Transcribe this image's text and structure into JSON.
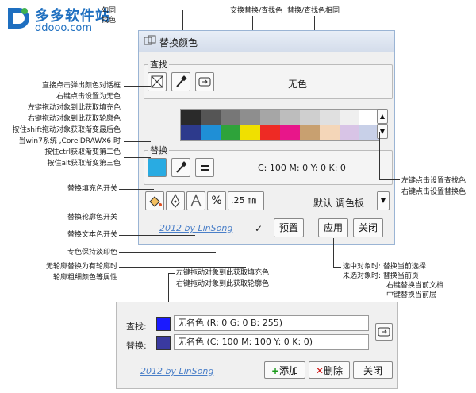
{
  "watermark": {
    "title": "多多软件站",
    "url": "ddooo.com"
  },
  "top_annotations": {
    "a1_line1": "勾同",
    "a1_line2": "找色",
    "swap_find_colors": "交换替换/查找色",
    "replace_same": "替换/查找色相同"
  },
  "left_annotations": [
    "直接点击弹出颜色对话框",
    "右键点击设置为无色",
    "左键拖动对象到此获取填充色",
    "右键拖动对象到此获取轮廓色",
    "按住shift拖动对象获取渐变最后色",
    "当win7系统 ,CorelDRAWX6 时",
    "按住ctrl获取渐变第二色",
    "按住alt获取渐变第三色"
  ],
  "toggle_annotations": {
    "fill": "替换填充色开关",
    "outline": "替换轮廓色开关",
    "text": "替换文本色开关",
    "spot": "专色保持淡印色",
    "no_outline_1": "无轮廓替换为有轮廓时",
    "no_outline_2": "轮廓粗细颜色等属性"
  },
  "right_annotations": {
    "find_set": "左键点击设置查找色",
    "replace_set": "右键点击设置替换色",
    "selected": "选中对象时:  替换当前选择",
    "unselected": "未选对象时:  替换当前页",
    "right_doc": "右键替换当前文档",
    "middle_layer": "中键替换当前层"
  },
  "mid_annotations": {
    "left_fill": "左键拖动对象到此获取填充色",
    "right_outline": "右键拖动对象到此获取轮廓色"
  },
  "dialog": {
    "title": "替换颜色",
    "find_label": "查找",
    "find_value": "无色",
    "replace_label": "替换",
    "replace_value": "C: 100 M: 0 Y: 0 K: 0",
    "outline_width": ".25 ㎜",
    "palette_select": "默认 调色板",
    "credit": "2012 by LinSong",
    "preset_button": "预置",
    "apply_button": "应用",
    "close_button": "关闭",
    "checkbox_mark": "✓"
  },
  "compact": {
    "find_label": "查找:",
    "find_value": "无名色 (R: 0 G: 0 B: 255)",
    "replace_label": "替换:",
    "replace_value": "无名色 (C: 100 M: 100 Y: 0 K: 0)",
    "credit": "2012 by LinSong",
    "add_icon": "+",
    "add_button": "添加",
    "delete_icon": "✕",
    "delete_button": "删除",
    "close_button": "关闭"
  },
  "colors": {
    "accent": "#29abe2",
    "find_swatch": "#1a1aff",
    "replace_swatch": "#3a3aa0",
    "palette_row1": [
      "#2a2a2a",
      "#555555",
      "#777777",
      "#8e8e8e",
      "#a6a6a6",
      "#bdbdbd",
      "#cfcfcf",
      "#e0e0e0",
      "#efefef",
      "#ffffff"
    ],
    "palette_row2": [
      "#2d3a8c",
      "#1f8fd6",
      "#2ea33a",
      "#f0e000",
      "#ee2a24",
      "#e8168a",
      "#c8a070",
      "#f4d6b8",
      "#d8c4e6",
      "#c8d0e8"
    ]
  }
}
